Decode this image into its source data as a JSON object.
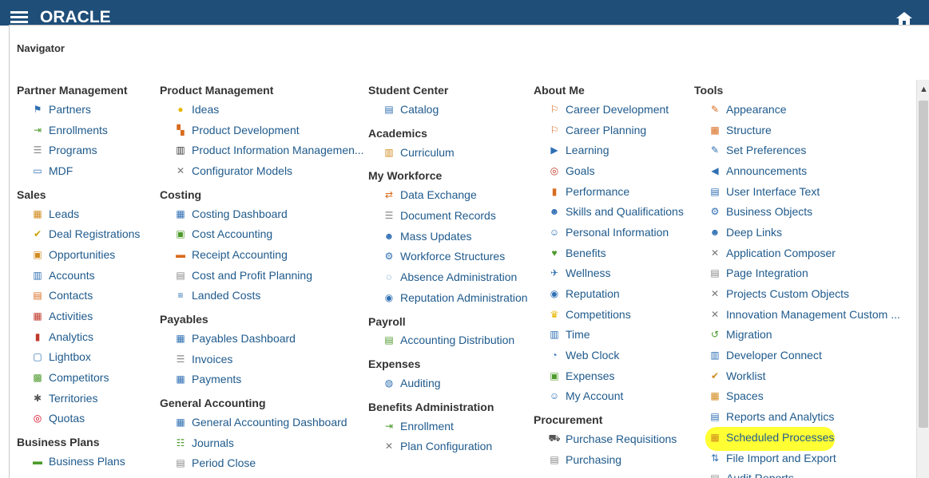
{
  "topbar": {
    "logo": "ORACLE"
  },
  "navigator": {
    "title": "Navigator"
  },
  "columns": [
    {
      "groups": [
        {
          "title": "Partner Management",
          "items": [
            {
              "label": "Partners",
              "icon": "partners-icon"
            },
            {
              "label": "Enrollments",
              "icon": "enrollments-icon"
            },
            {
              "label": "Programs",
              "icon": "programs-icon"
            },
            {
              "label": "MDF",
              "icon": "mdf-icon"
            }
          ]
        },
        {
          "title": "Sales",
          "items": [
            {
              "label": "Leads",
              "icon": "leads-icon"
            },
            {
              "label": "Deal Registrations",
              "icon": "deal-registrations-icon"
            },
            {
              "label": "Opportunities",
              "icon": "opportunities-icon"
            },
            {
              "label": "Accounts",
              "icon": "accounts-icon"
            },
            {
              "label": "Contacts",
              "icon": "contacts-icon"
            },
            {
              "label": "Activities",
              "icon": "activities-icon"
            },
            {
              "label": "Analytics",
              "icon": "analytics-icon"
            },
            {
              "label": "Lightbox",
              "icon": "lightbox-icon"
            },
            {
              "label": "Competitors",
              "icon": "competitors-icon"
            },
            {
              "label": "Territories",
              "icon": "territories-icon"
            },
            {
              "label": "Quotas",
              "icon": "quotas-icon"
            }
          ]
        },
        {
          "title": "Business Plans",
          "items": [
            {
              "label": "Business Plans",
              "icon": "business-plans-icon"
            }
          ]
        }
      ]
    },
    {
      "groups": [
        {
          "title": "Product Management",
          "items": [
            {
              "label": "Ideas",
              "icon": "ideas-icon"
            },
            {
              "label": "Product Development",
              "icon": "product-development-icon"
            },
            {
              "label": "Product Information Managemen...",
              "icon": "barcode-icon"
            },
            {
              "label": "Configurator Models",
              "icon": "configurator-icon"
            }
          ]
        },
        {
          "title": "Costing",
          "items": [
            {
              "label": "Costing Dashboard",
              "icon": "dashboard-icon"
            },
            {
              "label": "Cost Accounting",
              "icon": "cost-accounting-icon"
            },
            {
              "label": "Receipt Accounting",
              "icon": "receipt-icon"
            },
            {
              "label": "Cost and Profit Planning",
              "icon": "planning-icon"
            },
            {
              "label": "Landed Costs",
              "icon": "landed-costs-icon"
            }
          ]
        },
        {
          "title": "Payables",
          "items": [
            {
              "label": "Payables Dashboard",
              "icon": "dashboard-icon"
            },
            {
              "label": "Invoices",
              "icon": "invoices-icon"
            },
            {
              "label": "Payments",
              "icon": "payments-icon"
            }
          ]
        },
        {
          "title": "General Accounting",
          "items": [
            {
              "label": "General Accounting Dashboard",
              "icon": "dashboard-icon"
            },
            {
              "label": "Journals",
              "icon": "journals-icon"
            },
            {
              "label": "Period Close",
              "icon": "period-close-icon"
            }
          ]
        }
      ]
    },
    {
      "groups": [
        {
          "title": "Student Center",
          "items": [
            {
              "label": "Catalog",
              "icon": "catalog-icon"
            }
          ]
        },
        {
          "title": "Academics",
          "items": [
            {
              "label": "Curriculum",
              "icon": "curriculum-icon"
            }
          ]
        },
        {
          "title": "My Workforce",
          "items": [
            {
              "label": "Data Exchange",
              "icon": "exchange-icon"
            },
            {
              "label": "Document Records",
              "icon": "document-icon"
            },
            {
              "label": "Mass Updates",
              "icon": "mass-updates-icon"
            },
            {
              "label": "Workforce Structures",
              "icon": "structures-icon"
            },
            {
              "label": "Absence Administration",
              "icon": "absence-icon"
            },
            {
              "label": "Reputation Administration",
              "icon": "reputation-icon"
            }
          ]
        },
        {
          "title": "Payroll",
          "items": [
            {
              "label": "Accounting Distribution",
              "icon": "distribution-icon"
            }
          ]
        },
        {
          "title": "Expenses",
          "items": [
            {
              "label": "Auditing",
              "icon": "auditing-icon"
            }
          ]
        },
        {
          "title": "Benefits Administration",
          "items": [
            {
              "label": "Enrollment",
              "icon": "enrollment-icon"
            },
            {
              "label": "Plan Configuration",
              "icon": "plan-config-icon"
            }
          ]
        }
      ]
    },
    {
      "groups": [
        {
          "title": "About Me",
          "items": [
            {
              "label": "Career Development",
              "icon": "signpost-icon"
            },
            {
              "label": "Career Planning",
              "icon": "signpost-icon"
            },
            {
              "label": "Learning",
              "icon": "learning-icon"
            },
            {
              "label": "Goals",
              "icon": "goals-icon"
            },
            {
              "label": "Performance",
              "icon": "performance-icon"
            },
            {
              "label": "Skills and Qualifications",
              "icon": "skills-icon"
            },
            {
              "label": "Personal Information",
              "icon": "person-icon"
            },
            {
              "label": "Benefits",
              "icon": "benefits-icon"
            },
            {
              "label": "Wellness",
              "icon": "wellness-icon"
            },
            {
              "label": "Reputation",
              "icon": "reputation-icon"
            },
            {
              "label": "Competitions",
              "icon": "competitions-icon"
            },
            {
              "label": "Time",
              "icon": "time-icon"
            },
            {
              "label": "Web Clock",
              "icon": "clock-icon"
            },
            {
              "label": "Expenses",
              "icon": "expenses-icon"
            },
            {
              "label": "My Account",
              "icon": "account-icon"
            }
          ]
        },
        {
          "title": "Procurement",
          "items": [
            {
              "label": "Purchase Requisitions",
              "icon": "cart-icon"
            },
            {
              "label": "Purchasing",
              "icon": "purchasing-icon"
            }
          ]
        }
      ]
    },
    {
      "groups": [
        {
          "title": "Tools",
          "items": [
            {
              "label": "Appearance",
              "icon": "appearance-icon"
            },
            {
              "label": "Structure",
              "icon": "structure-icon"
            },
            {
              "label": "Set Preferences",
              "icon": "preferences-icon"
            },
            {
              "label": "Announcements",
              "icon": "megaphone-icon"
            },
            {
              "label": "User Interface Text",
              "icon": "ui-text-icon"
            },
            {
              "label": "Business Objects",
              "icon": "gears-icon"
            },
            {
              "label": "Deep Links",
              "icon": "deep-links-icon"
            },
            {
              "label": "Application Composer",
              "icon": "composer-icon"
            },
            {
              "label": "Page Integration",
              "icon": "page-integration-icon"
            },
            {
              "label": "Projects Custom Objects",
              "icon": "projects-icon"
            },
            {
              "label": "Innovation Management Custom ...",
              "icon": "innovation-icon"
            },
            {
              "label": "Migration",
              "icon": "migration-icon"
            },
            {
              "label": "Developer Connect",
              "icon": "developer-icon"
            },
            {
              "label": "Worklist",
              "icon": "worklist-icon"
            },
            {
              "label": "Spaces",
              "icon": "spaces-icon"
            },
            {
              "label": "Reports and Analytics",
              "icon": "reports-icon"
            },
            {
              "label": "Scheduled Processes",
              "icon": "calendar-icon"
            },
            {
              "label": "File Import and Export",
              "icon": "import-export-icon"
            },
            {
              "label": "Audit Reports",
              "icon": "audit-icon"
            }
          ]
        }
      ]
    }
  ],
  "highlighted_item": "Scheduled Processes",
  "colors": {
    "topbar": "#1f4e79",
    "link": "#1f5a8c",
    "highlight": "#ffff33"
  }
}
